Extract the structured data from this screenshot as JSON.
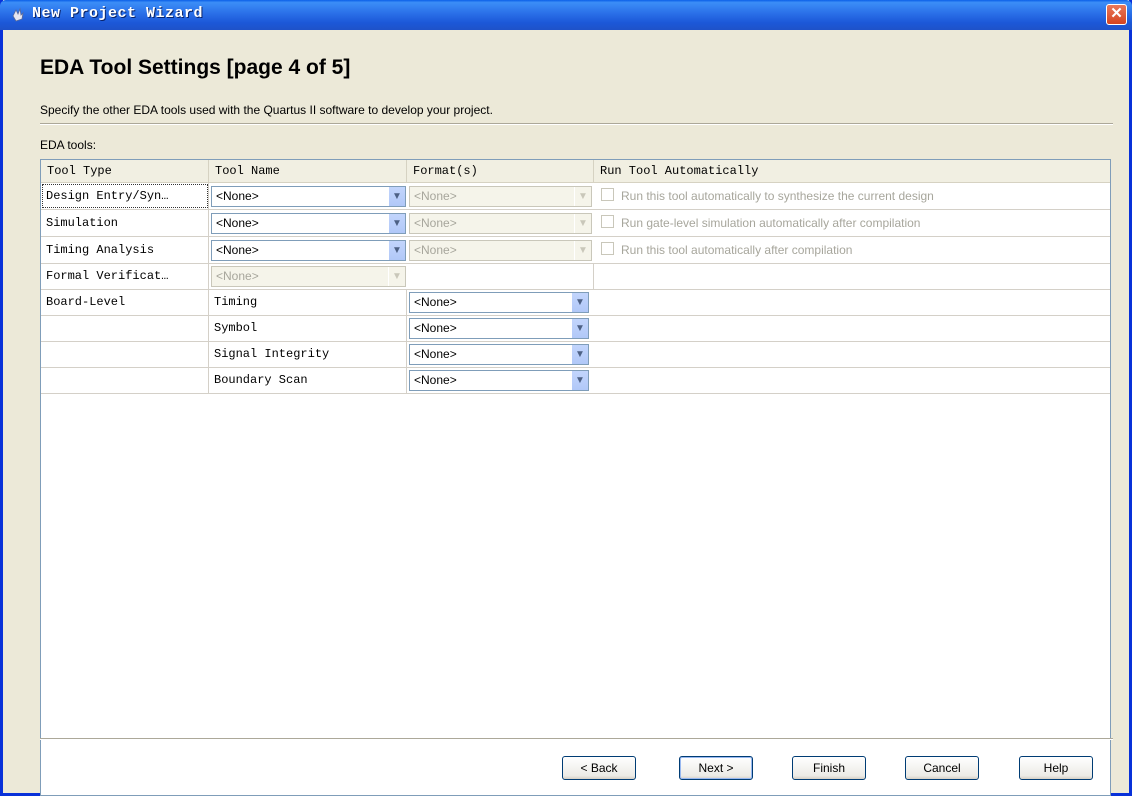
{
  "window": {
    "title": "New Project Wizard"
  },
  "page": {
    "title": "EDA Tool Settings [page 4 of 5]",
    "description": "Specify the other EDA tools used with the Quartus II software to develop your project.",
    "tools_label": "EDA tools:"
  },
  "table": {
    "headers": [
      "Tool Type",
      "Tool Name",
      "Format(s)",
      "Run Tool Automatically"
    ],
    "rows": [
      {
        "tool_type": "Design Entry/Syn…",
        "tool_name": "<None>",
        "format": "<None>",
        "run_label": "Run this tool automatically to synthesize the current design"
      },
      {
        "tool_type": "Simulation",
        "tool_name": "<None>",
        "format": "<None>",
        "run_label": "Run gate-level simulation automatically after compilation"
      },
      {
        "tool_type": "Timing Analysis",
        "tool_name": "<None>",
        "format": "<None>",
        "run_label": "Run this tool automatically after compilation"
      },
      {
        "tool_type": "Formal Verificat…",
        "tool_name": "<None>"
      },
      {
        "tool_type": "Board-Level",
        "tool_name": "Timing",
        "format": "<None>"
      },
      {
        "tool_type": "",
        "tool_name": "Symbol",
        "format": "<None>"
      },
      {
        "tool_type": "",
        "tool_name": "Signal Integrity",
        "format": "<None>"
      },
      {
        "tool_type": "",
        "tool_name": "Boundary Scan",
        "format": "<None>"
      }
    ]
  },
  "buttons": {
    "back": "< Back",
    "next": "Next >",
    "finish": "Finish",
    "cancel": "Cancel",
    "help": "Help"
  },
  "icons": {
    "title": "wizard-hand-icon",
    "close": "close-icon",
    "dropdown": "chevron-down-icon"
  },
  "colors": {
    "titlebar": "#0A5FE8",
    "window_bg": "#ECE9D8",
    "close": "#D5441F"
  }
}
